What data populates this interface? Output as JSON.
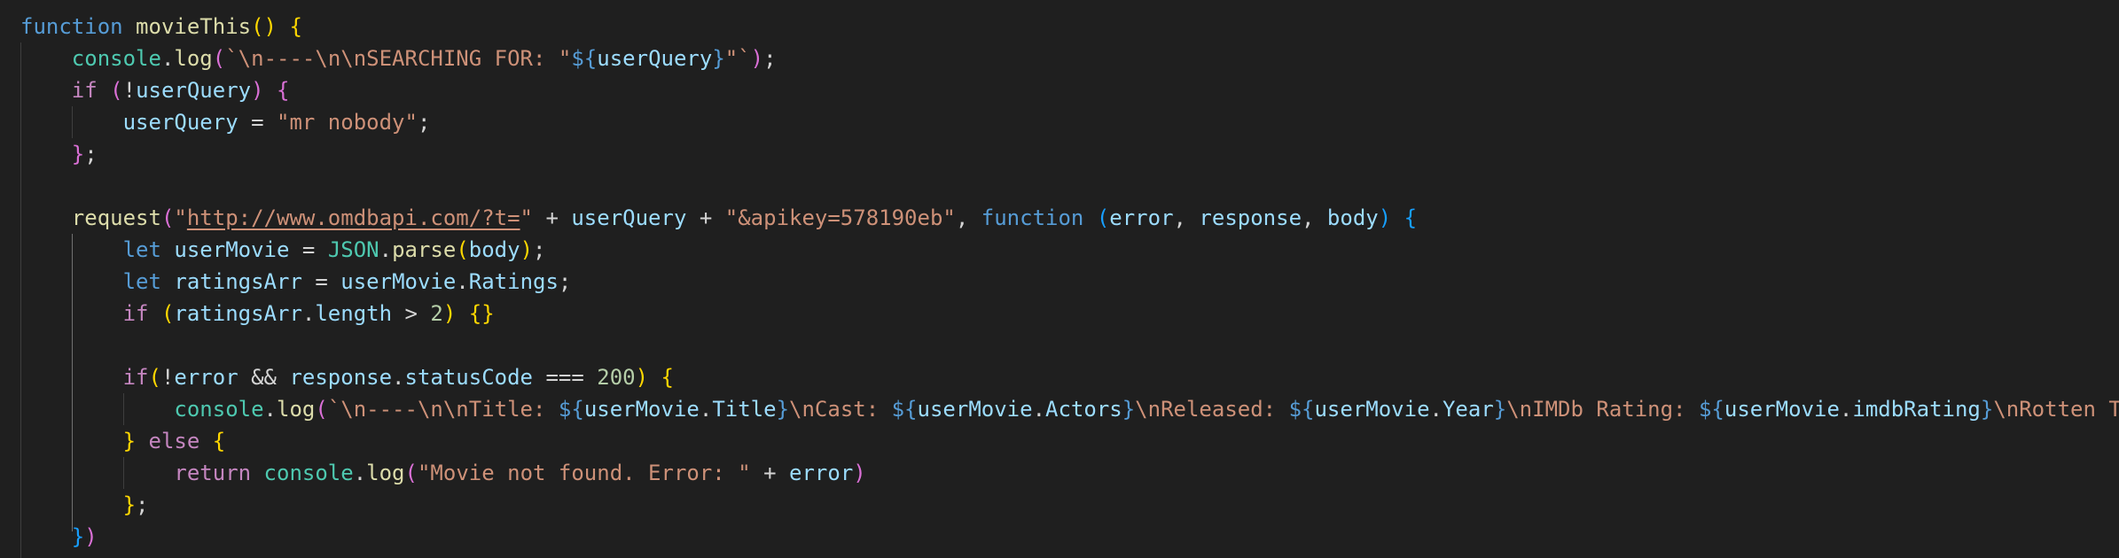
{
  "editor": {
    "language": "javascript",
    "theme": {
      "background": "#1f1f1f",
      "keyword": "#569cd6",
      "control": "#c586c0",
      "function": "#dcdcaa",
      "variable": "#9cdcfe",
      "class": "#4ec9b0",
      "string": "#ce9178",
      "number": "#b5cea8"
    },
    "lines": [
      [
        {
          "t": "function",
          "c": "kw"
        },
        {
          "t": " ",
          "c": "op"
        },
        {
          "t": "movieThis",
          "c": "fn"
        },
        {
          "t": "()",
          "c": "b1"
        },
        {
          "t": " ",
          "c": "op"
        },
        {
          "t": "{",
          "c": "b1"
        }
      ],
      [
        {
          "t": "    ",
          "c": "op"
        },
        {
          "t": "console",
          "c": "cls"
        },
        {
          "t": ".",
          "c": "op"
        },
        {
          "t": "log",
          "c": "fn"
        },
        {
          "t": "(",
          "c": "b2"
        },
        {
          "t": "`\\n----\\n\\nSEARCHING FOR: \"",
          "c": "str"
        },
        {
          "t": "${",
          "c": "kw"
        },
        {
          "t": "userQuery",
          "c": "var"
        },
        {
          "t": "}",
          "c": "kw"
        },
        {
          "t": "\"`",
          "c": "str"
        },
        {
          "t": ")",
          "c": "b2"
        },
        {
          "t": ";",
          "c": "op"
        }
      ],
      [
        {
          "t": "    ",
          "c": "op"
        },
        {
          "t": "if",
          "c": "ctl"
        },
        {
          "t": " ",
          "c": "op"
        },
        {
          "t": "(",
          "c": "b2"
        },
        {
          "t": "!",
          "c": "op"
        },
        {
          "t": "userQuery",
          "c": "var"
        },
        {
          "t": ")",
          "c": "b2"
        },
        {
          "t": " ",
          "c": "op"
        },
        {
          "t": "{",
          "c": "b2"
        }
      ],
      [
        {
          "t": "        ",
          "c": "op"
        },
        {
          "t": "userQuery",
          "c": "var"
        },
        {
          "t": " = ",
          "c": "op"
        },
        {
          "t": "\"mr nobody\"",
          "c": "str"
        },
        {
          "t": ";",
          "c": "op"
        }
      ],
      [
        {
          "t": "    ",
          "c": "op"
        },
        {
          "t": "}",
          "c": "b2"
        },
        {
          "t": ";",
          "c": "op"
        }
      ],
      [],
      [
        {
          "t": "    ",
          "c": "op"
        },
        {
          "t": "request",
          "c": "fn"
        },
        {
          "t": "(",
          "c": "b2"
        },
        {
          "t": "\"",
          "c": "str"
        },
        {
          "t": "http://www.omdbapi.com/?t=",
          "c": "url"
        },
        {
          "t": "\"",
          "c": "str"
        },
        {
          "t": " + ",
          "c": "op"
        },
        {
          "t": "userQuery",
          "c": "var"
        },
        {
          "t": " + ",
          "c": "op"
        },
        {
          "t": "\"&apikey=578190eb\"",
          "c": "str"
        },
        {
          "t": ", ",
          "c": "op"
        },
        {
          "t": "function",
          "c": "kw"
        },
        {
          "t": " ",
          "c": "op"
        },
        {
          "t": "(",
          "c": "b3"
        },
        {
          "t": "error",
          "c": "var"
        },
        {
          "t": ", ",
          "c": "op"
        },
        {
          "t": "response",
          "c": "var"
        },
        {
          "t": ", ",
          "c": "op"
        },
        {
          "t": "body",
          "c": "var"
        },
        {
          "t": ")",
          "c": "b3"
        },
        {
          "t": " ",
          "c": "op"
        },
        {
          "t": "{",
          "c": "b3"
        }
      ],
      [
        {
          "t": "        ",
          "c": "op"
        },
        {
          "t": "let",
          "c": "kw"
        },
        {
          "t": " ",
          "c": "op"
        },
        {
          "t": "userMovie",
          "c": "var"
        },
        {
          "t": " = ",
          "c": "op"
        },
        {
          "t": "JSON",
          "c": "cls"
        },
        {
          "t": ".",
          "c": "op"
        },
        {
          "t": "parse",
          "c": "fn"
        },
        {
          "t": "(",
          "c": "b1"
        },
        {
          "t": "body",
          "c": "var"
        },
        {
          "t": ")",
          "c": "b1"
        },
        {
          "t": ";",
          "c": "op"
        }
      ],
      [
        {
          "t": "        ",
          "c": "op"
        },
        {
          "t": "let",
          "c": "kw"
        },
        {
          "t": " ",
          "c": "op"
        },
        {
          "t": "ratingsArr",
          "c": "var"
        },
        {
          "t": " = ",
          "c": "op"
        },
        {
          "t": "userMovie",
          "c": "var"
        },
        {
          "t": ".",
          "c": "op"
        },
        {
          "t": "Ratings",
          "c": "var"
        },
        {
          "t": ";",
          "c": "op"
        }
      ],
      [
        {
          "t": "        ",
          "c": "op"
        },
        {
          "t": "if",
          "c": "ctl"
        },
        {
          "t": " ",
          "c": "op"
        },
        {
          "t": "(",
          "c": "b1"
        },
        {
          "t": "ratingsArr",
          "c": "var"
        },
        {
          "t": ".",
          "c": "op"
        },
        {
          "t": "length",
          "c": "var"
        },
        {
          "t": " > ",
          "c": "op"
        },
        {
          "t": "2",
          "c": "num"
        },
        {
          "t": ")",
          "c": "b1"
        },
        {
          "t": " ",
          "c": "op"
        },
        {
          "t": "{}",
          "c": "b1"
        }
      ],
      [],
      [
        {
          "t": "        ",
          "c": "op"
        },
        {
          "t": "if",
          "c": "ctl"
        },
        {
          "t": "(",
          "c": "b1"
        },
        {
          "t": "!",
          "c": "op"
        },
        {
          "t": "error",
          "c": "var"
        },
        {
          "t": " && ",
          "c": "op"
        },
        {
          "t": "response",
          "c": "var"
        },
        {
          "t": ".",
          "c": "op"
        },
        {
          "t": "statusCode",
          "c": "var"
        },
        {
          "t": " === ",
          "c": "op"
        },
        {
          "t": "200",
          "c": "num"
        },
        {
          "t": ")",
          "c": "b1"
        },
        {
          "t": " ",
          "c": "op"
        },
        {
          "t": "{",
          "c": "b1"
        }
      ],
      [
        {
          "t": "            ",
          "c": "op"
        },
        {
          "t": "console",
          "c": "cls"
        },
        {
          "t": ".",
          "c": "op"
        },
        {
          "t": "log",
          "c": "fn"
        },
        {
          "t": "(",
          "c": "b2"
        },
        {
          "t": "`\\n----\\n\\nTitle: ",
          "c": "str"
        },
        {
          "t": "${",
          "c": "kw"
        },
        {
          "t": "userMovie",
          "c": "var"
        },
        {
          "t": ".",
          "c": "op"
        },
        {
          "t": "Title",
          "c": "var"
        },
        {
          "t": "}",
          "c": "kw"
        },
        {
          "t": "\\nCast: ",
          "c": "str"
        },
        {
          "t": "${",
          "c": "kw"
        },
        {
          "t": "userMovie",
          "c": "var"
        },
        {
          "t": ".",
          "c": "op"
        },
        {
          "t": "Actors",
          "c": "var"
        },
        {
          "t": "}",
          "c": "kw"
        },
        {
          "t": "\\nReleased: ",
          "c": "str"
        },
        {
          "t": "${",
          "c": "kw"
        },
        {
          "t": "userMovie",
          "c": "var"
        },
        {
          "t": ".",
          "c": "op"
        },
        {
          "t": "Year",
          "c": "var"
        },
        {
          "t": "}",
          "c": "kw"
        },
        {
          "t": "\\nIMDb Rating: ",
          "c": "str"
        },
        {
          "t": "${",
          "c": "kw"
        },
        {
          "t": "userMovie",
          "c": "var"
        },
        {
          "t": ".",
          "c": "op"
        },
        {
          "t": "imdbRating",
          "c": "var"
        },
        {
          "t": "}",
          "c": "kw"
        },
        {
          "t": "\\nRotten T",
          "c": "str"
        }
      ],
      [
        {
          "t": "        ",
          "c": "op"
        },
        {
          "t": "}",
          "c": "b1"
        },
        {
          "t": " ",
          "c": "op"
        },
        {
          "t": "else",
          "c": "ctl"
        },
        {
          "t": " ",
          "c": "op"
        },
        {
          "t": "{",
          "c": "b1"
        }
      ],
      [
        {
          "t": "            ",
          "c": "op"
        },
        {
          "t": "return",
          "c": "ctl"
        },
        {
          "t": " ",
          "c": "op"
        },
        {
          "t": "console",
          "c": "cls"
        },
        {
          "t": ".",
          "c": "op"
        },
        {
          "t": "log",
          "c": "fn"
        },
        {
          "t": "(",
          "c": "b2"
        },
        {
          "t": "\"Movie not found. Error: \"",
          "c": "str"
        },
        {
          "t": " + ",
          "c": "op"
        },
        {
          "t": "error",
          "c": "var"
        },
        {
          "t": ")",
          "c": "b2"
        }
      ],
      [
        {
          "t": "        ",
          "c": "op"
        },
        {
          "t": "}",
          "c": "b1"
        },
        {
          "t": ";",
          "c": "op"
        }
      ],
      [
        {
          "t": "    ",
          "c": "op"
        },
        {
          "t": "}",
          "c": "b3"
        },
        {
          "t": ")",
          "c": "b2"
        }
      ]
    ]
  }
}
